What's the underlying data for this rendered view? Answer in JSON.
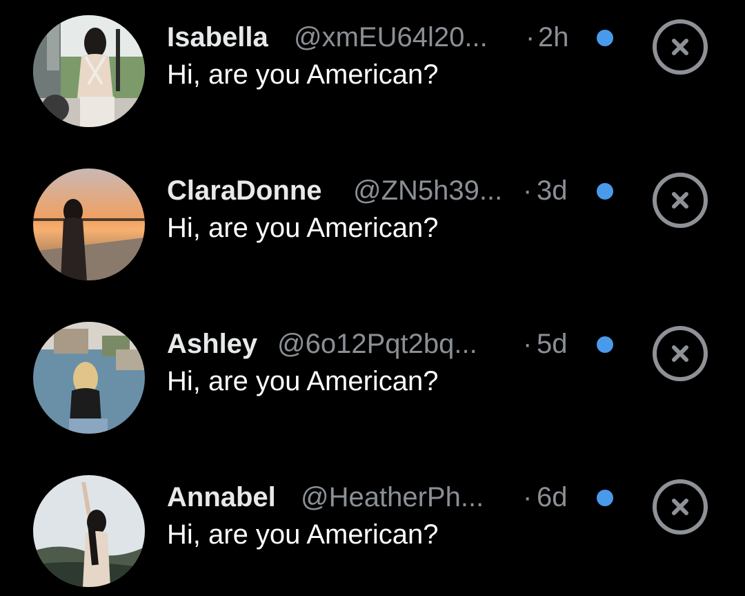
{
  "theme": {
    "background": "#000000",
    "unread_dot_color": "#4a9aeb",
    "muted_text": "#8b9096",
    "dismiss_color": "#8e9196"
  },
  "messages": [
    {
      "name": "Isabella",
      "handle": "@xmEU64l20...",
      "separator": "·",
      "time": "2h",
      "text": "Hi, are you American?",
      "unread": true,
      "avatar_icon": "avatar-photo"
    },
    {
      "name": "ClaraDonne",
      "handle": "@ZN5h39...",
      "separator": "·",
      "time": "3d",
      "text": "Hi, are you American?",
      "unread": true,
      "avatar_icon": "avatar-photo"
    },
    {
      "name": "Ashley",
      "handle": "@6o12Pqt2bq...",
      "separator": "·",
      "time": "5d",
      "text": "Hi, are you American?",
      "unread": true,
      "avatar_icon": "avatar-photo"
    },
    {
      "name": "Annabel",
      "handle": "@HeatherPh...",
      "separator": "·",
      "time": "6d",
      "text": "Hi, are you American?",
      "unread": true,
      "avatar_icon": "avatar-photo"
    }
  ],
  "dismiss_icon": "close-circle-icon"
}
